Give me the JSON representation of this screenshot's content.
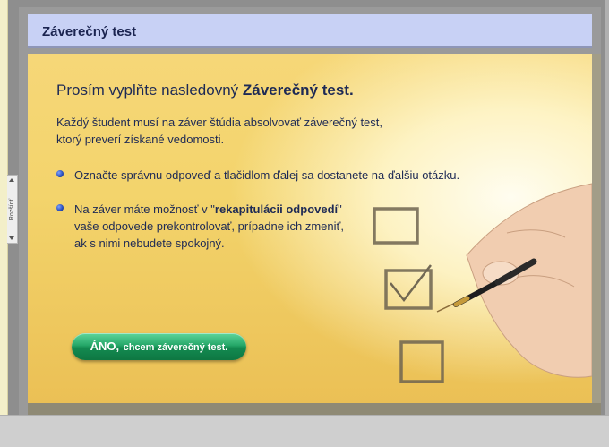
{
  "header": {
    "title": "Záverečný test"
  },
  "side_panel": {
    "label": "Rozšíriť"
  },
  "slide": {
    "headline_normal": "Prosím vyplňte nasledovný",
    "headline_bold": "Záverečný test.",
    "intro_line1": "Každý študent musí na záver štúdia absolvovať záverečný test,",
    "intro_line2": "ktorý preverí získané vedomosti.",
    "bullet1": "Označte správnu odpoveď a tlačidlom ďalej sa dostanete na ďalšiu otázku.",
    "bullet2_pre": "Na záver máte možnosť v \"",
    "bullet2_bold": "rekapitulácii odpovedí",
    "bullet2_post": "\"",
    "bullet2_line2": "vaše odpovede prekontrolovať, prípadne ich zmeniť,",
    "bullet2_line3": "ak s nimi nebudete spokojný."
  },
  "cta": {
    "strong": "ÁNO,",
    "rest": "chcem záverečný test."
  },
  "colors": {
    "header_bg": "#c8d1f5",
    "text": "#1e2a55",
    "button": "#1f9a5e",
    "slide_bg": "#f3d46c"
  }
}
